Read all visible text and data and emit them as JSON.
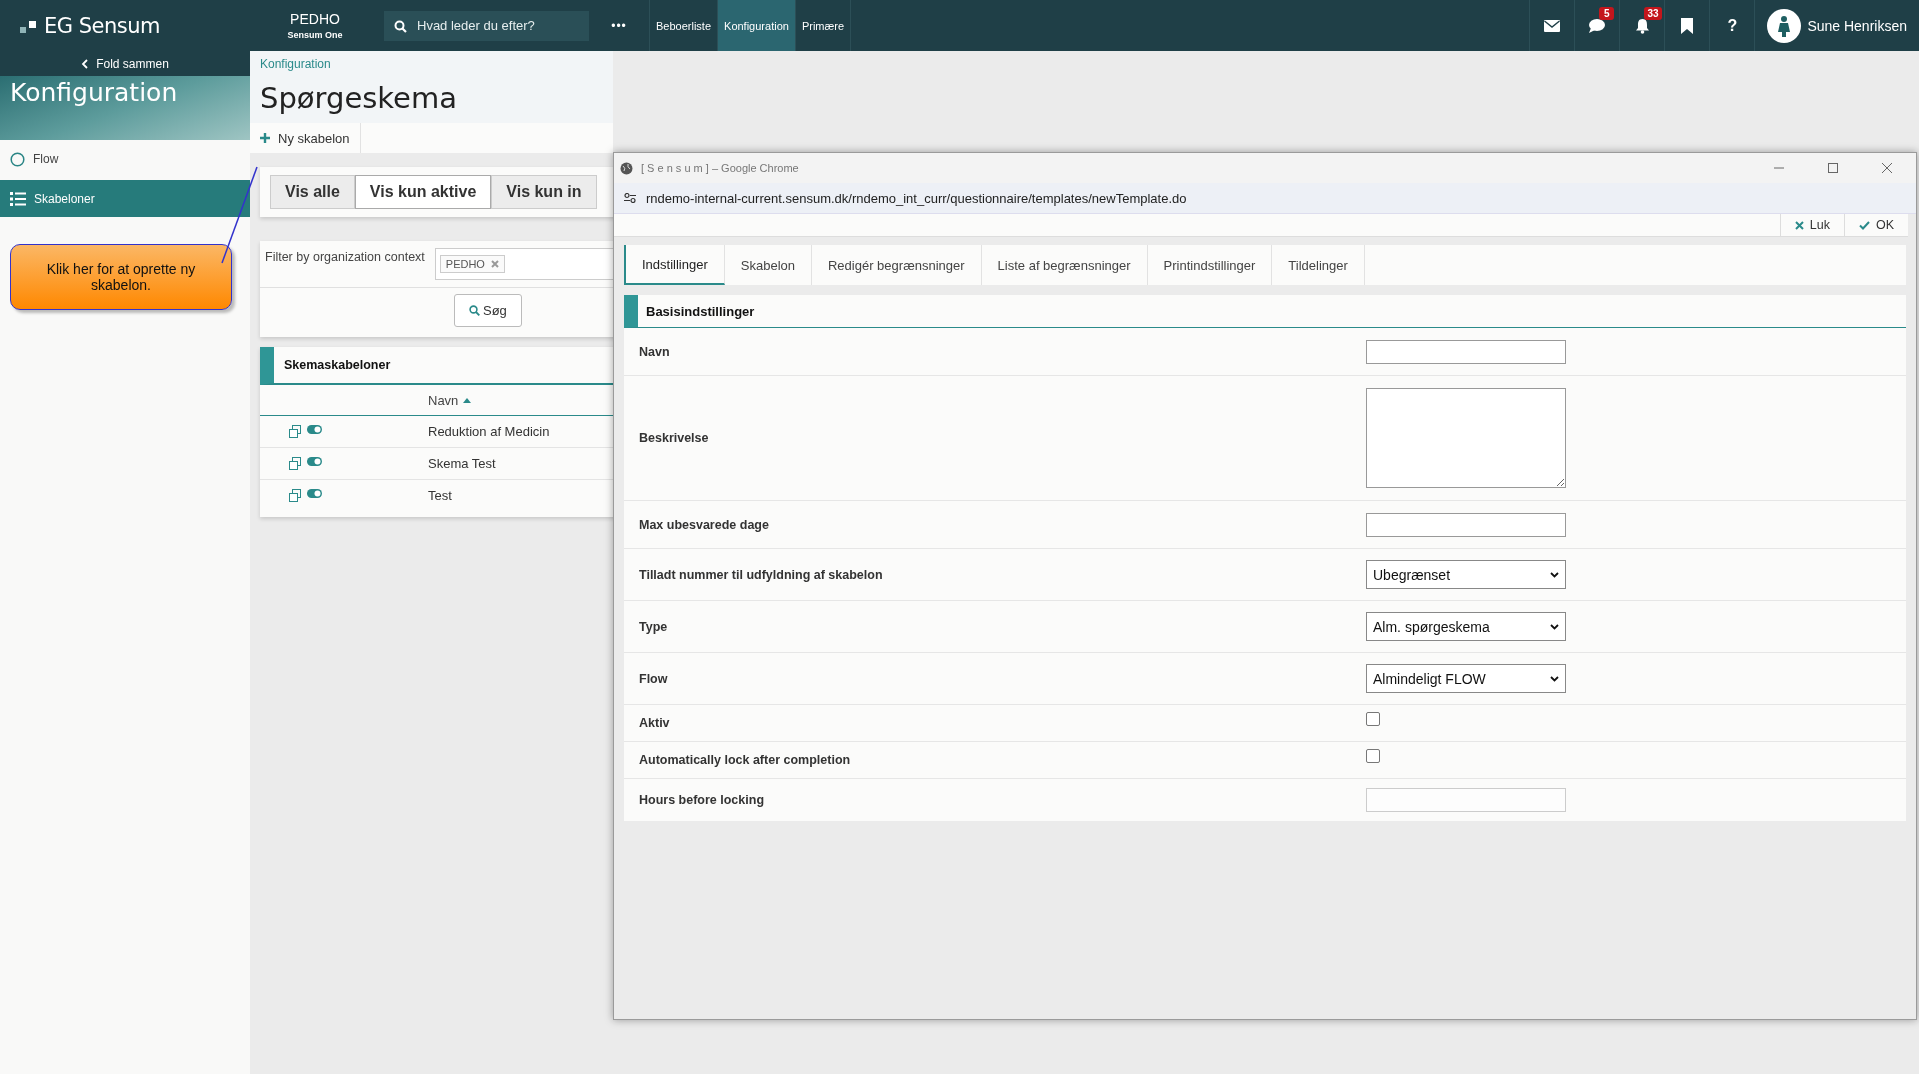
{
  "topbar": {
    "logo": "EG Sensum",
    "org": "PEDHO",
    "org_sub": "Sensum One",
    "search": {
      "placeholder": "Hvad leder du efter?"
    },
    "more": "•••",
    "nav": [
      {
        "label": "Beboerliste",
        "selected": false
      },
      {
        "label": "Konfiguration",
        "selected": true
      },
      {
        "label": "Primære",
        "selected": false
      }
    ],
    "icons": [
      {
        "kind": "mail"
      },
      {
        "kind": "chat",
        "badge": "5"
      },
      {
        "kind": "bell",
        "badge": "33"
      },
      {
        "kind": "bookmark"
      },
      {
        "kind": "help",
        "label": "?"
      }
    ],
    "user": "Sune Henriksen"
  },
  "sidebar": {
    "collapse": "Fold sammen",
    "title": "Konfiguration",
    "items": [
      {
        "label": "Flow",
        "kind": "circle",
        "selected": false
      },
      {
        "label": "Skabeloner",
        "kind": "list",
        "selected": true
      }
    ]
  },
  "callout": {
    "text": "Klik her for at oprette ny skabelon."
  },
  "main": {
    "breadcrumb": "Konfiguration",
    "title": "Spørgeskema",
    "toolbar": [
      {
        "label": "Ny skabelon"
      }
    ],
    "filter_tabs": [
      {
        "label": "Vis alle",
        "selected": false
      },
      {
        "label": "Vis kun aktive",
        "selected": true
      },
      {
        "label": "Vis kun in",
        "selected": false
      }
    ],
    "filter": {
      "label": "Filter by organization context",
      "tags": [
        "PEDHO"
      ],
      "search_button": "Søg"
    },
    "table": {
      "title": "Skemaskabeloner",
      "columns": [
        {
          "label": "Navn",
          "sorted": true
        }
      ],
      "rows": [
        {
          "name": "Reduktion af Medicin",
          "active": true
        },
        {
          "name": "Skema Test",
          "active": true
        },
        {
          "name": "Test",
          "active": true
        }
      ]
    }
  },
  "popup": {
    "title": "[ S e n s u m ] – Google Chrome",
    "url": "rndemo-internal-current.sensum.dk/rndemo_int_curr/questionnaire/templates/newTemplate.do",
    "actions": [
      {
        "kind": "close",
        "label": "Luk"
      },
      {
        "kind": "ok",
        "label": "OK"
      }
    ],
    "tabs": [
      {
        "label": "Indstillinger",
        "selected": true
      },
      {
        "label": "Skabelon",
        "selected": false
      },
      {
        "label": "Redigér begrænsninger",
        "selected": false
      },
      {
        "label": "Liste af begrænsninger",
        "selected": false
      },
      {
        "label": "Printindstillinger",
        "selected": false
      },
      {
        "label": "Tildelinger",
        "selected": false
      }
    ],
    "section": "Basisindstillinger",
    "fields": [
      {
        "label": "Navn",
        "kind": "text",
        "disabled": false
      },
      {
        "label": "Beskrivelse",
        "kind": "textarea",
        "disabled": false
      },
      {
        "label": "Max ubesvarede dage",
        "kind": "text",
        "disabled": false
      },
      {
        "label": "Tilladt nummer til udfyldning af skabelon",
        "kind": "select",
        "value": "Ubegrænset",
        "disabled": false
      },
      {
        "label": "Type",
        "kind": "select",
        "value": "Alm. spørgeskema",
        "disabled": false
      },
      {
        "label": "Flow",
        "kind": "select",
        "value": "Almindeligt FLOW",
        "disabled": false
      },
      {
        "label": "Aktiv",
        "kind": "checkbox",
        "checked": false,
        "disabled": false
      },
      {
        "label": "Automatically lock after completion",
        "kind": "checkbox",
        "checked": false,
        "disabled": false
      },
      {
        "label": "Hours before locking",
        "kind": "text",
        "disabled": true
      }
    ]
  }
}
